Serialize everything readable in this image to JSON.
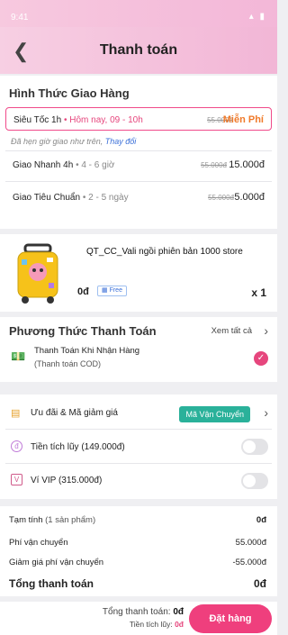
{
  "status_bar": {
    "time": "9:41",
    "system": "▴ ▮"
  },
  "header": {
    "title": "Thanh toán",
    "back_icon": "back-arrow-icon"
  },
  "shipping": {
    "title": "Hình Thức Giao Hàng",
    "options": [
      {
        "name": "Siêu Tốc 1h",
        "detail": "Hôm nay, 09 - 10h",
        "old_price": "55.000đ",
        "price": "Miễn Phí",
        "selected": true
      },
      {
        "name": "Giao Nhanh 4h",
        "detail": "4 - 6 giờ",
        "old_price": "55.000đ",
        "price": "15.000đ",
        "selected": false
      },
      {
        "name": "Giao Tiêu Chuẩn",
        "detail": "2 - 5 ngày",
        "old_price": "55.000đ",
        "price": "5.000đ",
        "selected": false
      }
    ],
    "note": "Đã hẹn giờ giao như trên,",
    "note_link": "Thay đổi"
  },
  "product": {
    "name": "QT_CC_Vali ngồi phiên bản 1000 store",
    "price": "0đ",
    "badge": "Free",
    "quantity": "x 1"
  },
  "payment": {
    "title": "Phương Thức Thanh Toán",
    "see_all": "Xem tất cả",
    "method": "Thanh Toán Khi Nhận Hàng",
    "method_sub": "(Thanh toán COD)"
  },
  "promotions": {
    "coupon_label": "Ưu đãi & Mã giảm giá",
    "coupon_tag": "Mã Vận Chuyển",
    "points_label": "Tiền tích lũy (149.000đ)",
    "vip_label": "Ví VIP (315.000đ)"
  },
  "summary": {
    "subtotal_label": "Tạm tính",
    "subtotal_count": "(1 sản phẩm)",
    "subtotal": "0đ",
    "shipping_label": "Phí vận chuyển",
    "shipping": "55.000đ",
    "discount_label": "Giảm giá phí vận chuyển",
    "discount": "-55.000đ",
    "total_label": "Tổng thanh toán",
    "total": "0đ"
  },
  "footer": {
    "total_label": "Tổng thanh toán:",
    "total": "0đ",
    "points_label": "Tiền tích lũy:",
    "points": "0đ",
    "order_button": "Đặt hàng"
  },
  "colors": {
    "accent": "#ef3f7d",
    "header_gradient": "#f2b6d6",
    "coupon": "#2ab19a"
  }
}
